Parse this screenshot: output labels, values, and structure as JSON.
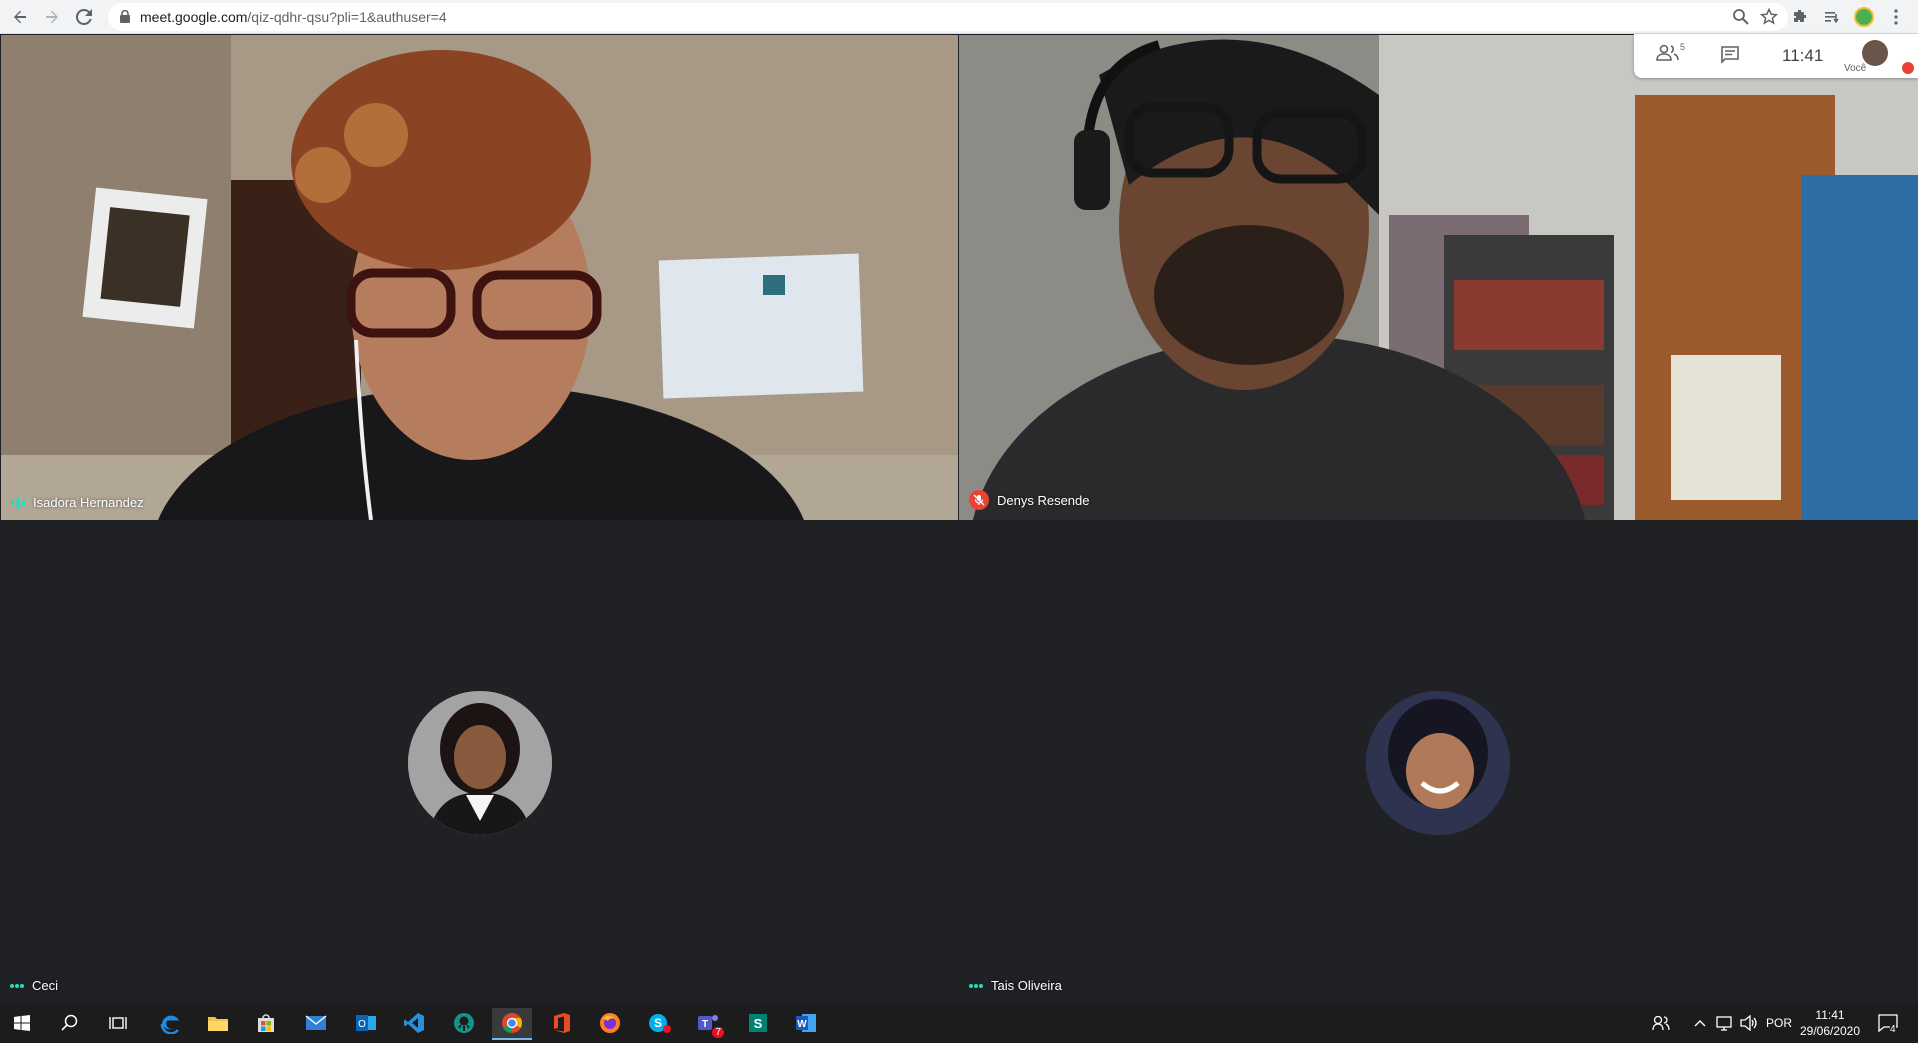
{
  "browser": {
    "url_host": "meet.google.com",
    "url_path": "/qiz-qdhr-qsu?pli=1&authuser=4"
  },
  "meet_panel": {
    "participants_count": "5",
    "clock": "11:41",
    "self_label": "Você"
  },
  "participants": [
    {
      "name": "Isadora Hernandez",
      "status": "speaking"
    },
    {
      "name": "Denys Resende",
      "status": "muted"
    },
    {
      "name": "Ceci",
      "status": "more"
    },
    {
      "name": "Tais Oliveira",
      "status": "more"
    }
  ],
  "taskbar": {
    "language": "POR",
    "time": "11:41",
    "date": "29/06/2020",
    "notification_count": "4",
    "teams_badge": "7",
    "apps": [
      "windows-start",
      "search",
      "task-view",
      "edge",
      "file-explorer",
      "store",
      "mail",
      "outlook",
      "vscode",
      "gitkraken",
      "chrome",
      "office",
      "firefox",
      "skype",
      "teams",
      "sway",
      "word"
    ]
  },
  "colors": {
    "meet_bg": "#202124",
    "muted_red": "#ea4335",
    "speaking_teal": "#1ee0c1",
    "taskbar": "#1c1c1c"
  }
}
